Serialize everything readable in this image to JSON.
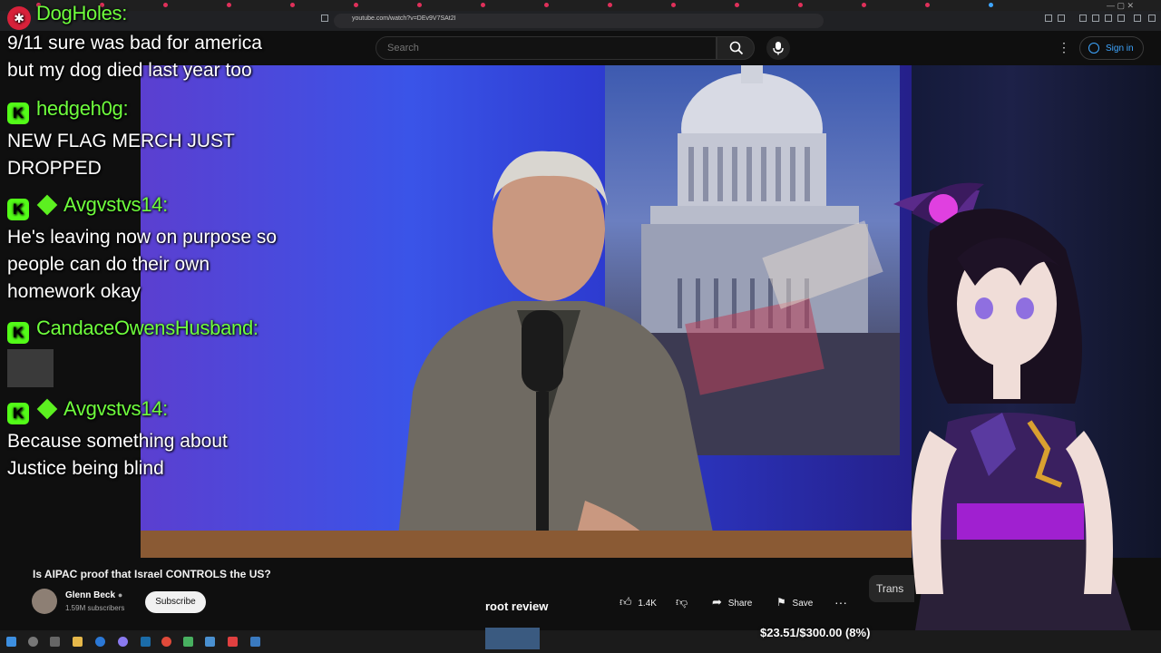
{
  "browser": {
    "url": "youtube.com/watch?v=DEv9V7SAt2I"
  },
  "header": {
    "search_placeholder": "Search",
    "sign_in_label": "Sign in"
  },
  "chat": {
    "messages": [
      {
        "username": "DogHoles:",
        "text_lines": [
          "9/11 sure was bad for america",
          "but my dog died last year too"
        ]
      },
      {
        "username": "hedgeh0g:",
        "text_lines": [
          "NEW FLAG MERCH JUST",
          "DROPPED"
        ]
      },
      {
        "username": "Avgvstvs14:",
        "text_lines": [
          "He's leaving now on purpose so",
          "people can do their own",
          "homework okay"
        ]
      },
      {
        "username": "CandaceOwensHusband:",
        "text_lines": []
      },
      {
        "username": "Avgvstvs14:",
        "text_lines": [
          "Because something about",
          "Justice being blind"
        ]
      }
    ],
    "kick_badge": "K"
  },
  "video": {
    "title": "Is AIPAC proof that Israel CONTROLS the US?",
    "channel_name": "Glenn Beck",
    "subscribers": "1.59M subscribers",
    "subscribe_label": "Subscribe",
    "likes": "1.4K",
    "share_label": "Share",
    "save_label": "Save",
    "transcript_partial": "Trans"
  },
  "stream_overlay": {
    "segment_label": "root review",
    "donation_goal_text": "$23.51/$300.00 (8%)",
    "donation_progress": 0.08
  },
  "colors": {
    "kick_green": "#53fc18",
    "link_blue": "#3ea6ff",
    "youtube_bg": "#0f0f0f"
  }
}
